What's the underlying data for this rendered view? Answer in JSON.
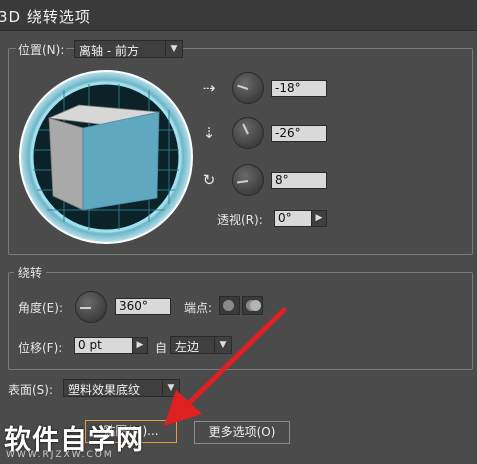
{
  "window": {
    "title": "3D 绕转选项"
  },
  "position": {
    "label": "位置(N):",
    "preset": "离轴 - 前方",
    "x_rotation": "-18°",
    "y_rotation": "-26°",
    "z_rotation": "8°",
    "perspective_label": "透视(R):",
    "perspective_value": "0°"
  },
  "revolve": {
    "legend": "绕转",
    "angle_label": "角度(E):",
    "angle_value": "360°",
    "cap_label": "端点:",
    "offset_label": "位移(F):",
    "offset_value": "0 pt",
    "from_label": "自",
    "from_value": "左边"
  },
  "surface": {
    "label": "表面(S):",
    "value": "塑料效果底纹"
  },
  "buttons": {
    "map_art": "贴图(M)...",
    "more_options": "更多选项(O)"
  },
  "watermark": {
    "text": "软件自学网",
    "sub": "WWW.RJZXW.COM"
  },
  "icons": [
    "x-axis-rotate-icon",
    "y-axis-rotate-icon",
    "z-axis-rotate-icon",
    "cap-on-icon",
    "cap-off-icon",
    "dropdown-arrow-icon",
    "red-arrow-annotation"
  ],
  "colors": {
    "panel": "#4b4b4b",
    "cube_front": "#5fa8c0",
    "cube_side": "#aeaeae",
    "ring": "#8fd0e0",
    "arrow": "#e02020"
  }
}
